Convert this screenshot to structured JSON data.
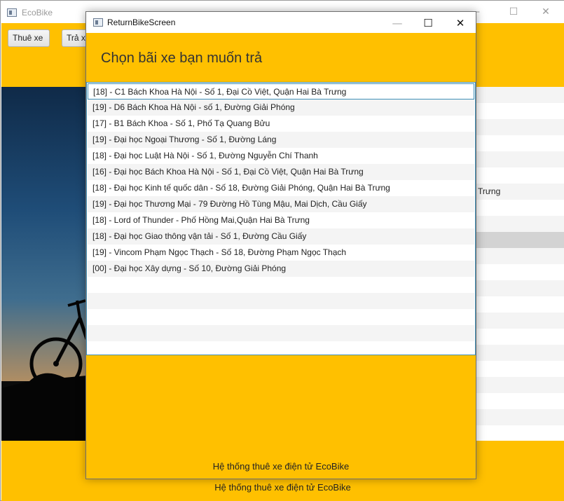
{
  "main_window": {
    "title": "EcoBike",
    "controls": {
      "minimize": "—",
      "maximize": "☐",
      "close": "✕"
    },
    "toolbar": {
      "rent_label": "Thuê xe",
      "return_label": "Trả xe"
    },
    "right_list": [
      {
        "text": "",
        "highlight": false
      },
      {
        "text": "",
        "highlight": false
      },
      {
        "text": "",
        "highlight": false
      },
      {
        "text": "",
        "highlight": false
      },
      {
        "text": "",
        "highlight": false
      },
      {
        "text": "",
        "highlight": false
      },
      {
        "text": "Trưng",
        "highlight": false
      },
      {
        "text": "",
        "highlight": false
      },
      {
        "text": "",
        "highlight": false
      },
      {
        "text": "",
        "highlight": true
      },
      {
        "text": "",
        "highlight": false
      },
      {
        "text": "",
        "highlight": false
      },
      {
        "text": "",
        "highlight": false
      },
      {
        "text": "",
        "highlight": false
      },
      {
        "text": "",
        "highlight": false
      },
      {
        "text": "",
        "highlight": false
      },
      {
        "text": "",
        "highlight": false
      },
      {
        "text": "",
        "highlight": false
      },
      {
        "text": "",
        "highlight": false
      },
      {
        "text": "",
        "highlight": false
      },
      {
        "text": "",
        "highlight": false
      }
    ],
    "footer_text": "Hệ thống thuê xe điện tử EcoBike"
  },
  "dialog": {
    "title": "ReturnBikeScreen",
    "controls": {
      "minimize": "—",
      "maximize": "☐",
      "close": "✕"
    },
    "heading": "Chọn bãi xe bạn muốn trả",
    "selected_index": 0,
    "stations": [
      "[18] - C1 Bách Khoa Hà Nội - Số 1, Đại Cồ Việt, Quận Hai Bà Trưng",
      "[19] - D6 Bách Khoa Hà Nội - số 1, Đường Giải Phóng",
      "[17] - B1 Bách Khoa - Số 1, Phố Tạ Quang Bửu",
      "[19] - Đại học Ngoại Thương - Số 1, Đường Láng",
      "[18] - Đại học Luật Hà Nội - Số 1, Đường Nguyễn Chí Thanh",
      "[16] - Đại học Bách Khoa Hà Nội - Số 1, Đại Cồ Việt, Quận Hai Bà Trưng",
      "[18] - Đại học Kinh tế quốc dân - Số 18, Đường Giải Phóng, Quận Hai Bà Trưng",
      "[19] - Đại học Thương Mại - 79 Đường Hồ Tùng Mậu, Mai Dịch, Cầu Giấy",
      "[18] - Lord of Thunder - Phố Hồng Mai,Quận Hai Bà Trưng",
      "[18] - Đại học Giao thông vận tải - Số 1, Đường Cầu Giấy",
      "[19] - Vincom Phạm Ngọc Thạch - Số 18, Đường Phạm Ngọc Thạch",
      "[00] - Đại học Xây dựng - Số 10, Đường Giải Phóng"
    ],
    "empty_rows": 5,
    "footer_text": "Hệ thống thuê xe điện tử EcoBike"
  },
  "colors": {
    "accent": "#ffc000",
    "selection_border": "#3f8fb7",
    "row_alt": "#f4f4f4",
    "highlight_row": "#d3d3d3"
  },
  "icons": {
    "app_icon": "window-app-icon",
    "bike_image": "bicycle-silhouette-image"
  }
}
